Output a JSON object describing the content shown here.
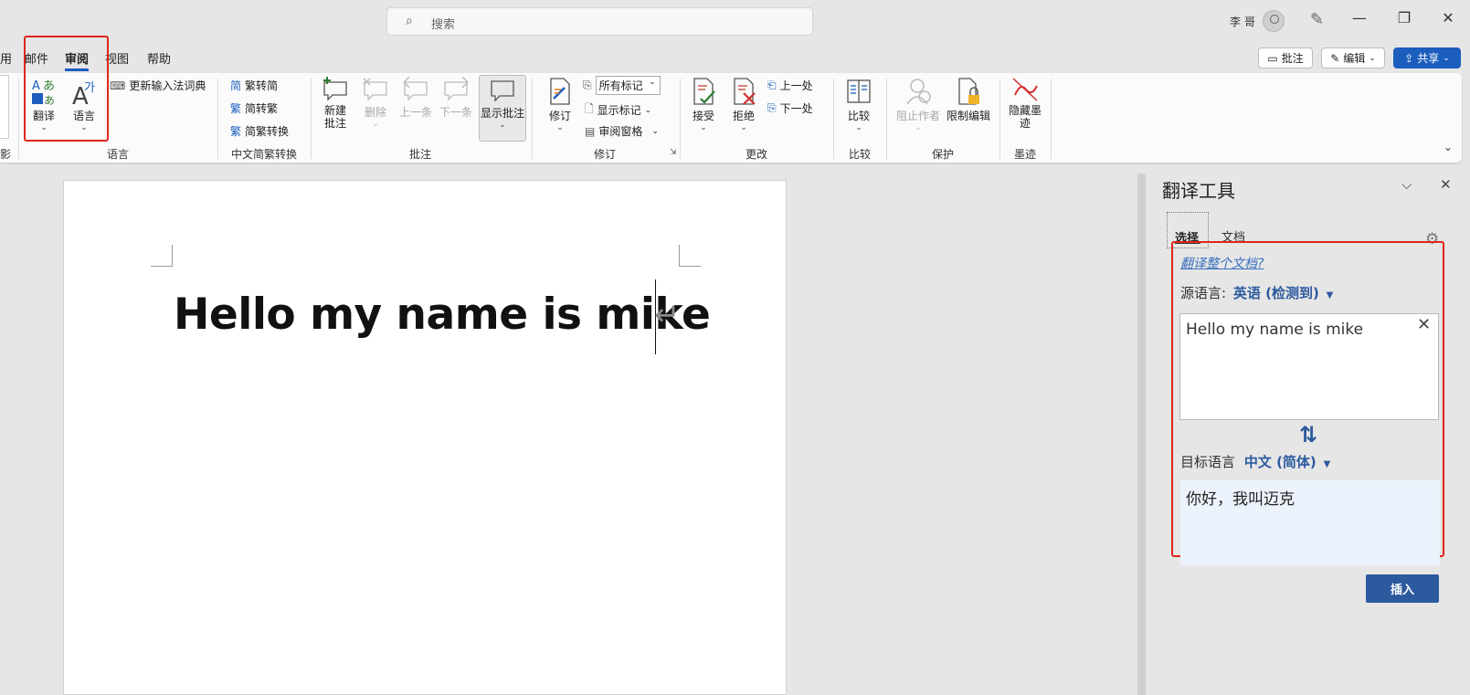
{
  "titlebar": {
    "search_placeholder": "搜索",
    "user_name": "李 哥"
  },
  "menu": {
    "tabs": [
      "用",
      "邮件",
      "审阅",
      "视图",
      "帮助"
    ],
    "active": "审阅",
    "comments_button": "批注",
    "edit_button": "编辑",
    "share_button": "共享"
  },
  "ribbon": {
    "edge_label": "影",
    "language": {
      "translate": "翻译",
      "language": "语言",
      "update_ime": "更新输入法词典",
      "group": "语言"
    },
    "chinese_conversion": {
      "trad_to_simp": "繁转简",
      "simp_to_trad": "简转繁",
      "conversion": "简繁转换",
      "group": "中文简繁转换"
    },
    "comments": {
      "new_comment": "新建\n批注",
      "delete": "删除",
      "previous": "上一条",
      "next": "下一条",
      "show_comments": "显示批注",
      "group": "批注"
    },
    "tracking": {
      "track_changes": "修订",
      "all_markup": "所有标记",
      "show_markup": "显示标记",
      "review_pane": "审阅窗格",
      "group": "修订"
    },
    "changes": {
      "accept": "接受",
      "reject": "拒绝",
      "previous": "上一处",
      "next": "下一处",
      "group": "更改"
    },
    "compare": {
      "compare": "比较",
      "group": "比较"
    },
    "protect": {
      "block_authors": "阻止作者",
      "restrict_editing": "限制编辑",
      "group": "保护"
    },
    "ink": {
      "hide_ink": "隐藏墨\n迹",
      "group": "墨迹"
    }
  },
  "document": {
    "text": "Hello my name is mike",
    "paragraph_mark": "↵"
  },
  "translator": {
    "title": "翻译工具",
    "tabs": [
      "选择",
      "文档"
    ],
    "translate_doc_link": "翻译整个文档?",
    "source_label": "源语言:",
    "source_lang": "英语 (检测到)",
    "source_text": "Hello my name is mike",
    "target_label": "目标语言",
    "target_lang": "中文 (简体)",
    "target_text": "你好，我叫迈克",
    "insert_button": "插入"
  },
  "colors": {
    "accent": "#1b5ebe",
    "highlight_box": "#e0251b",
    "link": "#3a6fbf",
    "target_bg": "#ecf2fb"
  }
}
